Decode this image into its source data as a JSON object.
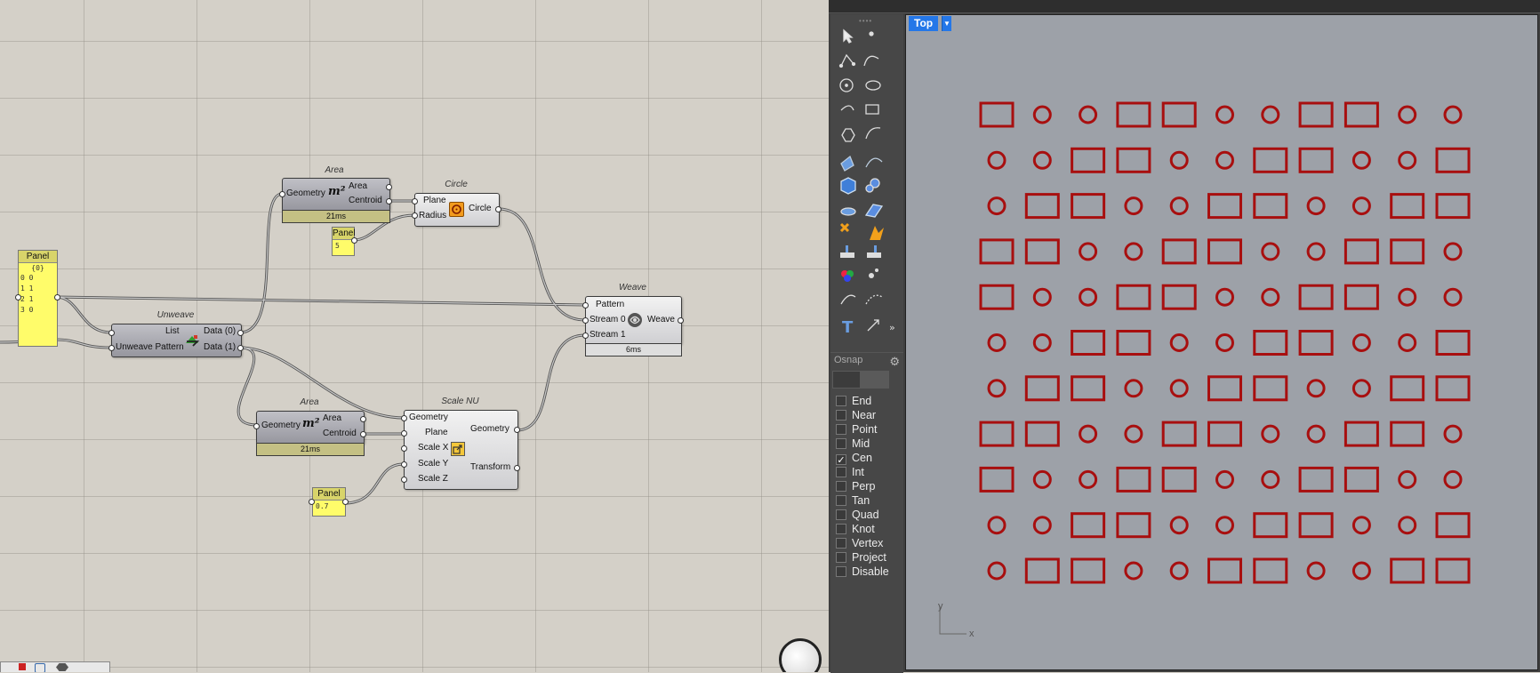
{
  "canvas": {
    "components": {
      "area_top": {
        "caption": "Area",
        "input": "Geometry",
        "icon_text": "m²",
        "outputs": [
          "Area",
          "Centroid"
        ],
        "time": "21ms"
      },
      "circle": {
        "caption": "Circle",
        "inputs": [
          "Plane",
          "Radius"
        ],
        "output": "Circle"
      },
      "panel_radius": {
        "title": "Panel",
        "value": "5"
      },
      "panel_pattern": {
        "title": "Panel",
        "path": "{0}",
        "rows": [
          {
            "i": "0",
            "v": "0"
          },
          {
            "i": "1",
            "v": "1"
          },
          {
            "i": "2",
            "v": "1"
          },
          {
            "i": "3",
            "v": "0"
          }
        ]
      },
      "unweave": {
        "caption": "Unweave",
        "inputs": [
          "List",
          "Unweave Pattern"
        ],
        "outputs": [
          "Data (0)",
          "Data (1)"
        ]
      },
      "weave": {
        "caption": "Weave",
        "inputs": [
          "Pattern",
          "Stream 0",
          "Stream 1"
        ],
        "output": "Weave",
        "time": "6ms"
      },
      "area_bottom": {
        "caption": "Area",
        "input": "Geometry",
        "icon_text": "m²",
        "outputs": [
          "Area",
          "Centroid"
        ],
        "time": "21ms"
      },
      "scale_nu": {
        "caption": "Scale NU",
        "inputs": [
          "Geometry",
          "Plane",
          "Scale X",
          "Scale Y",
          "Scale Z"
        ],
        "outputs": [
          "Geometry",
          "Transform"
        ]
      },
      "panel_scale": {
        "title": "Panel",
        "value": "0.7"
      }
    }
  },
  "rhino": {
    "viewport": {
      "tab_label": "Top",
      "axis_x": "x",
      "axis_y": "y",
      "pattern_color": "#a80f0f",
      "background": "#9da1a8"
    },
    "osnap": {
      "title": "Osnap",
      "items": [
        {
          "label": "End",
          "checked": false
        },
        {
          "label": "Near",
          "checked": false
        },
        {
          "label": "Point",
          "checked": false
        },
        {
          "label": "Mid",
          "checked": false
        },
        {
          "label": "Cen",
          "checked": true
        },
        {
          "label": "Int",
          "checked": false
        },
        {
          "label": "Perp",
          "checked": false
        },
        {
          "label": "Tan",
          "checked": false
        },
        {
          "label": "Quad",
          "checked": false
        },
        {
          "label": "Knot",
          "checked": false
        },
        {
          "label": "Vertex",
          "checked": false
        },
        {
          "label": "Project",
          "checked": false
        },
        {
          "label": "Disable",
          "checked": false
        }
      ]
    },
    "grid_rows": [
      "RCCRRCCRRCC",
      "CCRRCCRRCCR",
      "CRRCCRRCCRR",
      "RRCCRRCCRRC",
      "RCCRRCCRRCC",
      "CCRRCCRRCCR",
      "CRRCCRRCCRR",
      "RRCCRRCCRRC",
      "RCCRRCCRRCC",
      "CCRRCCRRCCR",
      "CRRCCRRCCRR"
    ]
  }
}
